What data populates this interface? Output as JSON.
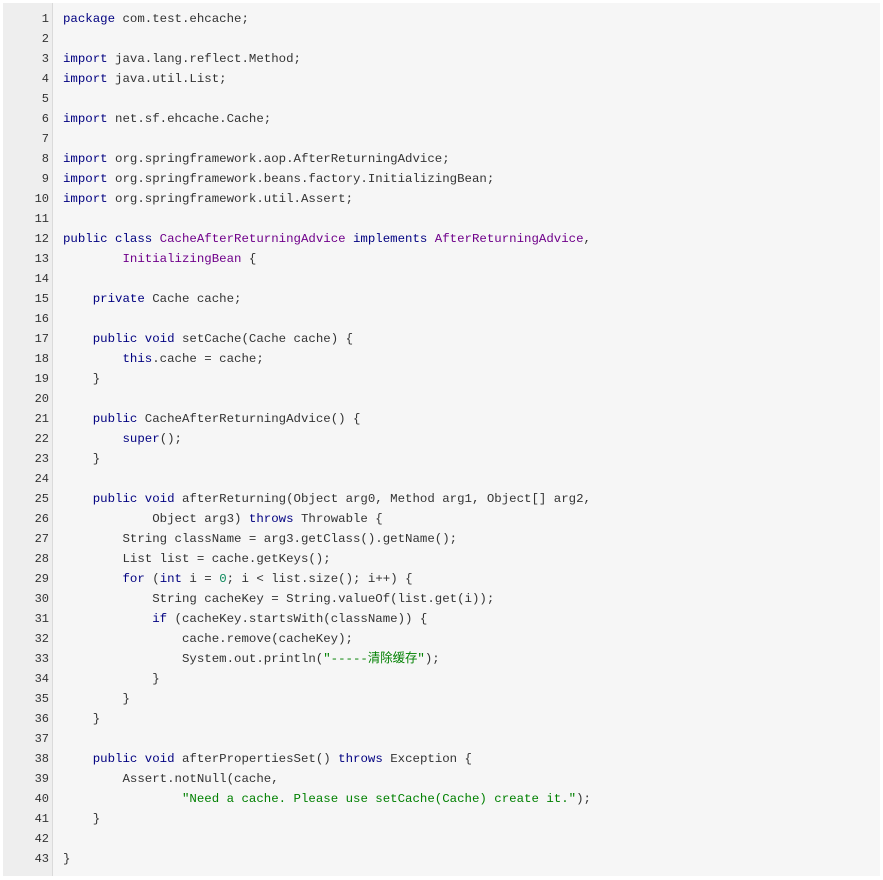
{
  "code": {
    "lines": [
      {
        "n": "1",
        "segs": [
          {
            "t": "package",
            "c": "kw"
          },
          {
            "t": " com.test.ehcache;"
          }
        ]
      },
      {
        "n": "2",
        "segs": []
      },
      {
        "n": "3",
        "segs": [
          {
            "t": "import",
            "c": "kw"
          },
          {
            "t": " java.lang.reflect.Method;"
          }
        ]
      },
      {
        "n": "4",
        "segs": [
          {
            "t": "import",
            "c": "kw"
          },
          {
            "t": " java.util.List;"
          }
        ]
      },
      {
        "n": "5",
        "segs": []
      },
      {
        "n": "6",
        "segs": [
          {
            "t": "import",
            "c": "kw"
          },
          {
            "t": " net.sf.ehcache.Cache;"
          }
        ]
      },
      {
        "n": "7",
        "segs": []
      },
      {
        "n": "8",
        "segs": [
          {
            "t": "import",
            "c": "kw"
          },
          {
            "t": " org.springframework.aop.AfterReturningAdvice;"
          }
        ]
      },
      {
        "n": "9",
        "segs": [
          {
            "t": "import",
            "c": "kw"
          },
          {
            "t": " org.springframework.beans.factory.InitializingBean;"
          }
        ]
      },
      {
        "n": "10",
        "segs": [
          {
            "t": "import",
            "c": "kw"
          },
          {
            "t": " org.springframework.util.Assert;"
          }
        ]
      },
      {
        "n": "11",
        "segs": []
      },
      {
        "n": "12",
        "segs": [
          {
            "t": "public class",
            "c": "kw"
          },
          {
            "t": " "
          },
          {
            "t": "CacheAfterReturningAdvice",
            "c": "ty"
          },
          {
            "t": " "
          },
          {
            "t": "implements",
            "c": "kw"
          },
          {
            "t": " "
          },
          {
            "t": "AfterReturningAdvice",
            "c": "ty"
          },
          {
            "t": ","
          }
        ]
      },
      {
        "n": "13",
        "segs": [
          {
            "t": "        "
          },
          {
            "t": "InitializingBean",
            "c": "ty"
          },
          {
            "t": " {"
          }
        ]
      },
      {
        "n": "14",
        "segs": []
      },
      {
        "n": "15",
        "segs": [
          {
            "t": "    "
          },
          {
            "t": "private",
            "c": "kw"
          },
          {
            "t": " Cache cache;"
          }
        ]
      },
      {
        "n": "16",
        "segs": []
      },
      {
        "n": "17",
        "segs": [
          {
            "t": "    "
          },
          {
            "t": "public void",
            "c": "kw"
          },
          {
            "t": " setCache(Cache cache) {"
          }
        ]
      },
      {
        "n": "18",
        "segs": [
          {
            "t": "        "
          },
          {
            "t": "this",
            "c": "kw"
          },
          {
            "t": ".cache = cache;"
          }
        ]
      },
      {
        "n": "19",
        "segs": [
          {
            "t": "    }"
          }
        ]
      },
      {
        "n": "20",
        "segs": []
      },
      {
        "n": "21",
        "segs": [
          {
            "t": "    "
          },
          {
            "t": "public",
            "c": "kw"
          },
          {
            "t": " CacheAfterReturningAdvice() {"
          }
        ]
      },
      {
        "n": "22",
        "segs": [
          {
            "t": "        "
          },
          {
            "t": "super",
            "c": "kw"
          },
          {
            "t": "();"
          }
        ]
      },
      {
        "n": "23",
        "segs": [
          {
            "t": "    }"
          }
        ]
      },
      {
        "n": "24",
        "segs": []
      },
      {
        "n": "25",
        "segs": [
          {
            "t": "    "
          },
          {
            "t": "public void",
            "c": "kw"
          },
          {
            "t": " afterReturning(Object arg0, Method arg1, Object[] arg2,"
          }
        ]
      },
      {
        "n": "26",
        "segs": [
          {
            "t": "            Object arg3) "
          },
          {
            "t": "throws",
            "c": "kw"
          },
          {
            "t": " Throwable {"
          }
        ]
      },
      {
        "n": "27",
        "segs": [
          {
            "t": "        String className = arg3.getClass().getName();"
          }
        ]
      },
      {
        "n": "28",
        "segs": [
          {
            "t": "        List list = cache.getKeys();"
          }
        ]
      },
      {
        "n": "29",
        "segs": [
          {
            "t": "        "
          },
          {
            "t": "for",
            "c": "kw"
          },
          {
            "t": " ("
          },
          {
            "t": "int",
            "c": "kw"
          },
          {
            "t": " i = "
          },
          {
            "t": "0",
            "c": "num"
          },
          {
            "t": "; i < list.size(); i++) {"
          }
        ]
      },
      {
        "n": "30",
        "segs": [
          {
            "t": "            String cacheKey = String.valueOf(list.get(i));"
          }
        ]
      },
      {
        "n": "31",
        "segs": [
          {
            "t": "            "
          },
          {
            "t": "if",
            "c": "kw"
          },
          {
            "t": " (cacheKey.startsWith(className)) {"
          }
        ]
      },
      {
        "n": "32",
        "segs": [
          {
            "t": "                cache.remove(cacheKey);"
          }
        ]
      },
      {
        "n": "33",
        "segs": [
          {
            "t": "                System.out.println("
          },
          {
            "t": "\"-----清除缓存\"",
            "c": "str"
          },
          {
            "t": ");"
          }
        ]
      },
      {
        "n": "34",
        "segs": [
          {
            "t": "            }"
          }
        ]
      },
      {
        "n": "35",
        "segs": [
          {
            "t": "        }"
          }
        ]
      },
      {
        "n": "36",
        "segs": [
          {
            "t": "    }"
          }
        ]
      },
      {
        "n": "37",
        "segs": []
      },
      {
        "n": "38",
        "segs": [
          {
            "t": "    "
          },
          {
            "t": "public void",
            "c": "kw"
          },
          {
            "t": " afterPropertiesSet() "
          },
          {
            "t": "throws",
            "c": "kw"
          },
          {
            "t": " Exception {"
          }
        ]
      },
      {
        "n": "39",
        "segs": [
          {
            "t": "        Assert.notNull(cache,"
          }
        ]
      },
      {
        "n": "40",
        "segs": [
          {
            "t": "                "
          },
          {
            "t": "\"Need a cache. Please use setCache(Cache) create it.\"",
            "c": "str"
          },
          {
            "t": ");"
          }
        ]
      },
      {
        "n": "41",
        "segs": [
          {
            "t": "    }"
          }
        ]
      },
      {
        "n": "42",
        "segs": []
      },
      {
        "n": "43",
        "segs": [
          {
            "t": "}"
          }
        ]
      }
    ]
  }
}
